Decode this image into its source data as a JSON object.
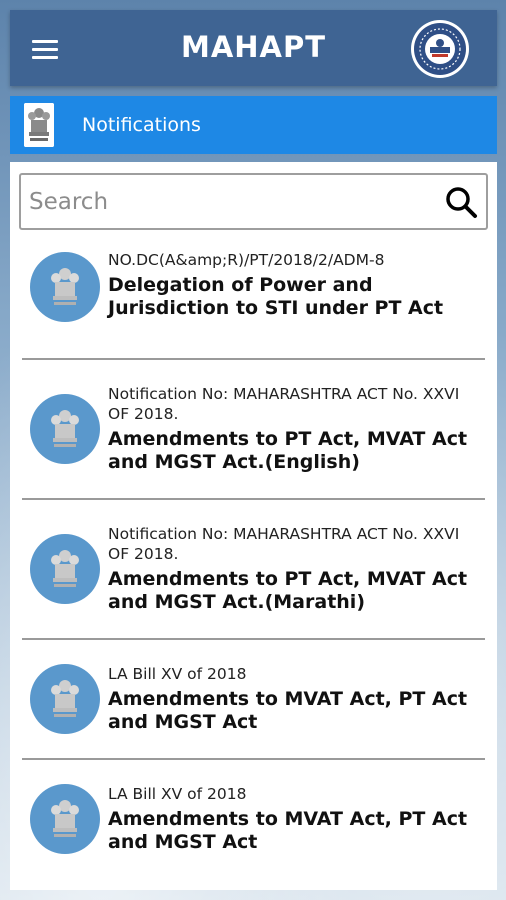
{
  "header": {
    "title": "MAHAPT"
  },
  "section": {
    "title": "Notifications"
  },
  "search": {
    "placeholder": "Search",
    "value": ""
  },
  "notifications": [
    {
      "ref": "NO.DC(A&amp;R)/PT/2018/2/ADM-8",
      "title": "Delegation of Power and Jurisdiction to STI under PT Act"
    },
    {
      "ref": "Notification No: MAHARASHTRA ACT No. XXVI OF 2018.",
      "title": "Amendments to PT Act, MVAT Act and MGST Act.(English)"
    },
    {
      "ref": "Notification No: MAHARASHTRA ACT No. XXVI OF 2018.",
      "title": "Amendments to PT Act, MVAT Act and MGST Act.(Marathi)"
    },
    {
      "ref": "LA Bill XV of 2018",
      "title": "Amendments to MVAT Act, PT Act and MGST Act"
    },
    {
      "ref": "LA Bill XV of 2018",
      "title": "Amendments to MVAT Act, PT Act and MGST Act"
    }
  ],
  "colors": {
    "app_bar": "#3f6493",
    "section_bar": "#1e88e5",
    "avatar": "#5a98cc"
  },
  "icons": {
    "menu": "hamburger-menu-icon",
    "logo": "department-seal-logo",
    "emblem": "state-emblem-icon",
    "search": "search-icon"
  }
}
